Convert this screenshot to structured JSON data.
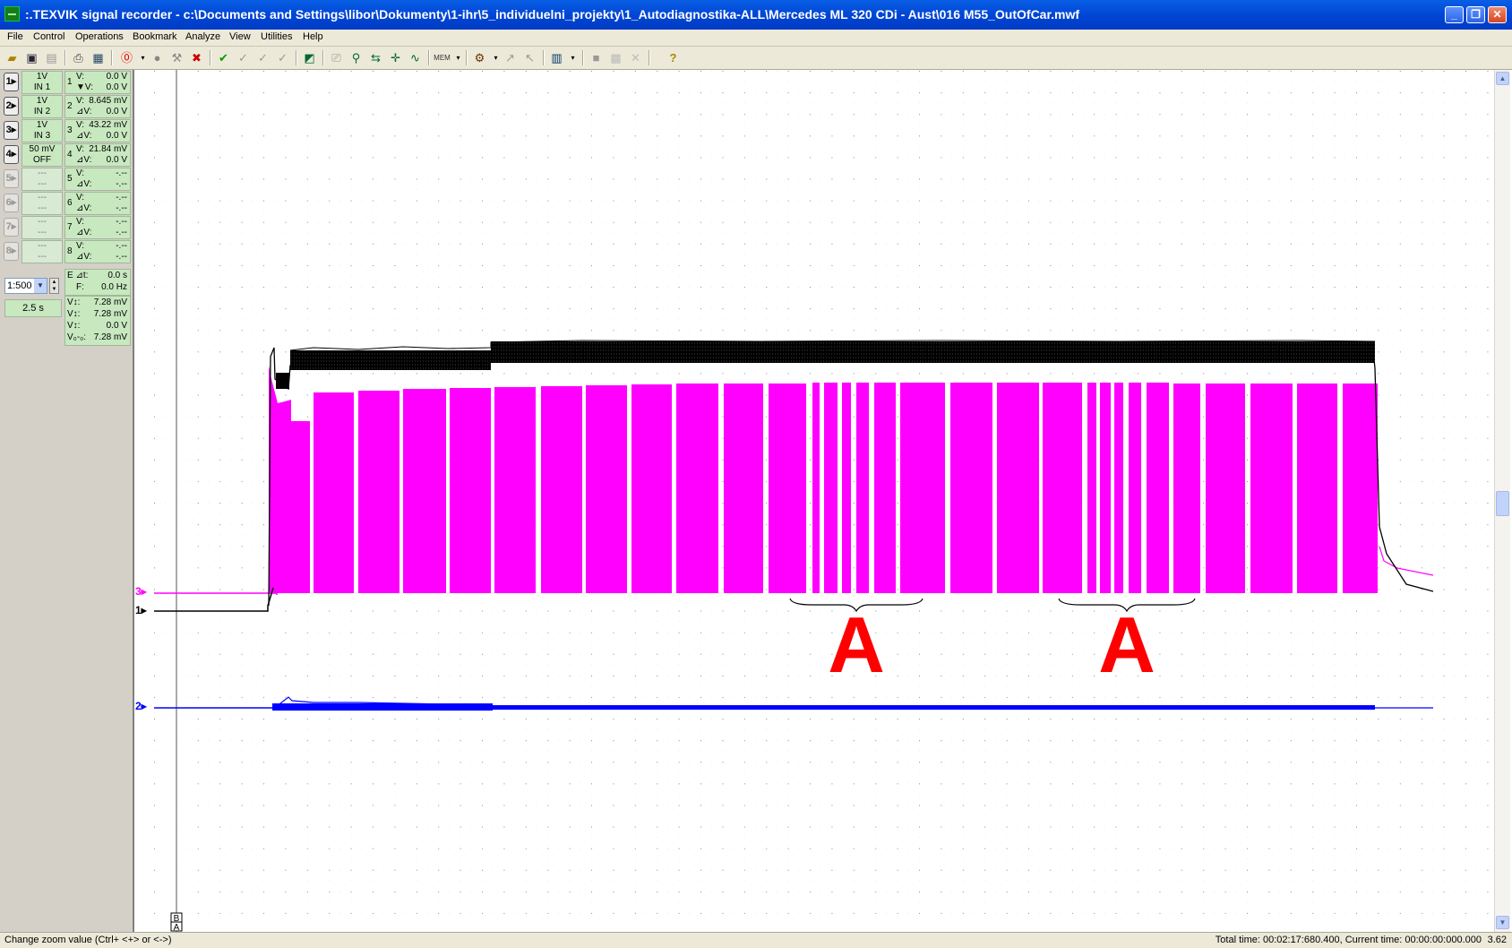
{
  "window": {
    "title": ":.TEXVIK  signal recorder - c:\\Documents and Settings\\libor\\Dokumenty\\1-ihr\\5_individuelni_projekty\\1_Autodiagnostika-ALL\\Mercedes ML 320 CDi - Aust\\016 M55_OutOfCar.mwf",
    "minimize": "_",
    "restore": "❐",
    "close": "✕"
  },
  "menu": [
    "File",
    "Control",
    "Operations",
    "Bookmark",
    "Analyze",
    "View",
    "Utilities",
    "Help"
  ],
  "channels": [
    {
      "id": "1",
      "range": "1V",
      "input": "IN 1"
    },
    {
      "id": "2",
      "range": "1V",
      "input": "IN 2"
    },
    {
      "id": "3",
      "range": "1V",
      "input": "IN 3"
    },
    {
      "id": "4",
      "range": "50 mV",
      "input": "OFF"
    },
    {
      "id": "5",
      "range": "---",
      "input": "---"
    },
    {
      "id": "6",
      "range": "---",
      "input": "---"
    },
    {
      "id": "7",
      "range": "---",
      "input": "---"
    },
    {
      "id": "8",
      "range": "---",
      "input": "---"
    }
  ],
  "measurements": [
    {
      "n": "1",
      "v": "0.0 V",
      "dv": "0.0 V",
      "l1": "V:",
      "l2": "▼V:"
    },
    {
      "n": "2",
      "v": "8.645 mV",
      "dv": "0.0 V",
      "l1": "V:",
      "l2": "⊿V:"
    },
    {
      "n": "3",
      "v": "43.22 mV",
      "dv": "0.0 V",
      "l1": "V:",
      "l2": "⊿V:"
    },
    {
      "n": "4",
      "v": "21.84 mV",
      "dv": "0.0 V",
      "l1": "V:",
      "l2": "⊿V:"
    },
    {
      "n": "5",
      "v": "-.--",
      "dv": "-.--",
      "l1": "V:",
      "l2": "⊿V:"
    },
    {
      "n": "6",
      "v": "-.--",
      "dv": "-.--",
      "l1": "V:",
      "l2": "⊿V:"
    },
    {
      "n": "7",
      "v": "-.--",
      "dv": "-.--",
      "l1": "V:",
      "l2": "⊿V:"
    },
    {
      "n": "8",
      "v": "-.--",
      "dv": "-.--",
      "l1": "V:",
      "l2": "⊿V:"
    }
  ],
  "zoom": "1:500",
  "timebase": "2.5 s",
  "cursor": {
    "dt_label": "E ⊿t:",
    "dt": "0.0 s",
    "f_label": "F:",
    "f": "0.0 Hz"
  },
  "voltages": [
    {
      "k": "V↕:",
      "v": "7.28 mV"
    },
    {
      "k": "V↕:",
      "v": "7.28 mV"
    },
    {
      "k": "V↕:",
      "v": "0.0 V"
    },
    {
      "k": "V₀-₀:",
      "v": "7.28 mV"
    }
  ],
  "scope": {
    "markers": {
      "ch3": "3▸",
      "ch1": "1▸",
      "ch2": "2▸"
    },
    "bookmark_b": "B",
    "bookmark_a": "A",
    "annotation_1": "A",
    "annotation_2": "A",
    "colors": {
      "ch1": "#000000",
      "ch2": "#0000ff",
      "ch3": "#ff00ff",
      "annotation": "#ff0000",
      "grid": "#888888"
    }
  },
  "status": {
    "hint": "Change zoom value (Ctrl+ <+> or <->)",
    "times": "Total time: 00:02:17:680.400, Current time: 00:00:00:000.000",
    "extra": "3.62"
  }
}
